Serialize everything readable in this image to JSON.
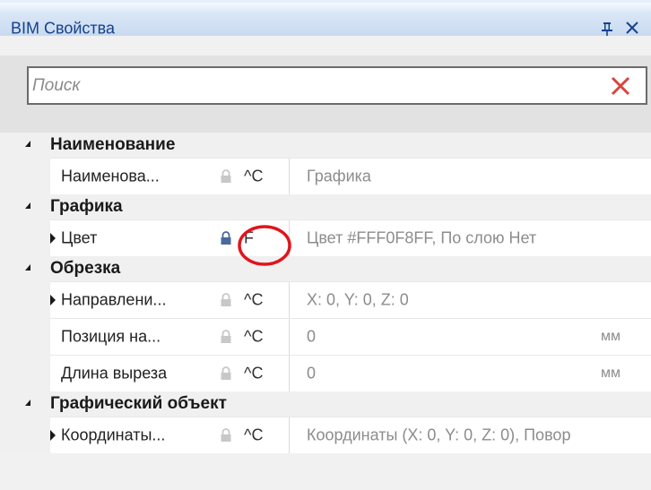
{
  "panel": {
    "title": "BIM Свойства",
    "pin_icon": "pin-icon",
    "close_icon": "close-icon"
  },
  "search": {
    "placeholder": "Поиск",
    "value": "",
    "clear_icon": "clear-x-icon",
    "clear_color": "#d9453a"
  },
  "categories": [
    {
      "label": "Наименование",
      "rows": [
        {
          "name": "Наименова...",
          "flag": "^C",
          "value": "Графика",
          "unit": "",
          "expandable": false,
          "lock": "disabled"
        }
      ]
    },
    {
      "label": "Графика",
      "rows": [
        {
          "name": "Цвет",
          "flag": "F",
          "value": "Цвет #FFF0F8FF, По слою Нет",
          "unit": "",
          "expandable": true,
          "lock": "enabled"
        }
      ]
    },
    {
      "label": "Обрезка",
      "rows": [
        {
          "name": "Направлени...",
          "flag": "^C",
          "value": "X: 0, Y: 0, Z: 0",
          "unit": "",
          "expandable": true,
          "lock": "disabled"
        },
        {
          "name": "Позиция на...",
          "flag": "^C",
          "value": "0",
          "unit": "мм",
          "expandable": false,
          "lock": "disabled"
        },
        {
          "name": "Длина выреза",
          "flag": "^C",
          "value": "0",
          "unit": "мм",
          "expandable": false,
          "lock": "disabled"
        }
      ]
    },
    {
      "label": "Графический объект",
      "rows": [
        {
          "name": "Координаты...",
          "flag": "^C",
          "value": "Координаты (X: 0, Y: 0, Z: 0), Повор",
          "unit": "",
          "expandable": true,
          "lock": "disabled"
        }
      ]
    }
  ],
  "colors": {
    "title_text": "#15428b",
    "annotation_circle": "#e0151b",
    "value_text": "#8c8c8c"
  }
}
